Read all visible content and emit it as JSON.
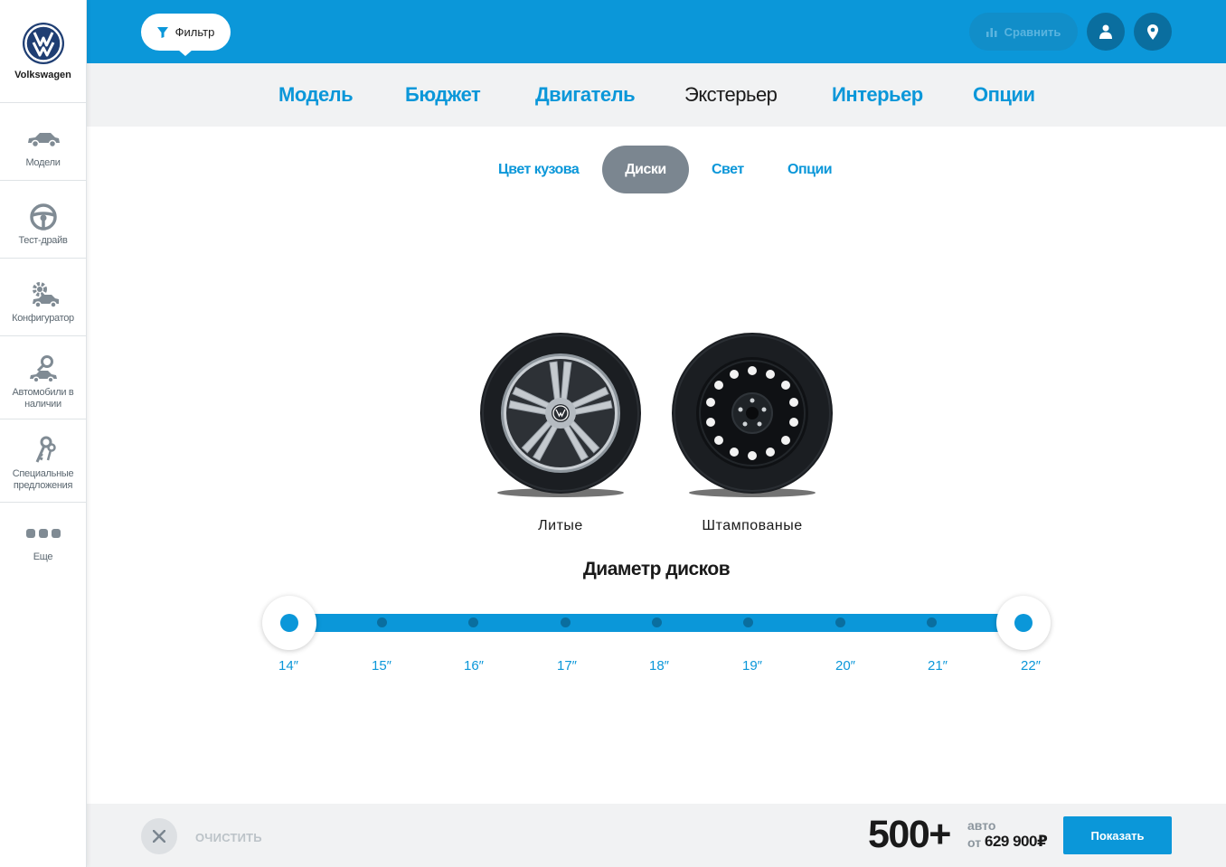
{
  "brand": {
    "name": "Volkswagen",
    "logo_icon": "vw-logo-icon"
  },
  "sidebar": {
    "items": [
      {
        "label": "Модели",
        "icon": "car-icon"
      },
      {
        "label": "Тест-драйв",
        "icon": "steering-wheel-icon"
      },
      {
        "label": "Конфигуратор",
        "icon": "gear-car-icon"
      },
      {
        "label": "Автомобили в наличии",
        "icon": "car-search-icon"
      },
      {
        "label": "Специальные предложения",
        "icon": "keys-icon"
      },
      {
        "label": "Еще",
        "icon": "more-dots-icon"
      }
    ]
  },
  "topbar": {
    "filter_label": "Фильтр",
    "compare_label": "Сравнить",
    "user_icon": "user-icon",
    "location_icon": "location-pin-icon"
  },
  "main_tabs": [
    {
      "label": "Модель"
    },
    {
      "label": "Бюджет"
    },
    {
      "label": "Двигатель"
    },
    {
      "label": "Экстерьер",
      "active": true
    },
    {
      "label": "Интерьер"
    },
    {
      "label": "Опции"
    }
  ],
  "sub_tabs": [
    {
      "label": "Цвет кузова"
    },
    {
      "label": "Диски",
      "active": true
    },
    {
      "label": "Свет"
    },
    {
      "label": "Опции"
    }
  ],
  "wheel_types": [
    {
      "label": "Литые",
      "icon": "alloy-wheel-icon"
    },
    {
      "label": "Штампованые",
      "icon": "steel-wheel-icon"
    }
  ],
  "diameter": {
    "title": "Диаметр дисков",
    "ticks": [
      "14″",
      "15″",
      "16″",
      "17″",
      "18″",
      "19″",
      "20″",
      "21″",
      "22″"
    ],
    "selected_min": "14″",
    "selected_max": "22″"
  },
  "footer": {
    "clear_label": "ОЧИСТИТЬ",
    "count": "500+",
    "count_unit": "авто",
    "price_prefix": "от",
    "price": "629 900₽",
    "show_label": "Показать"
  },
  "colors": {
    "accent": "#0b97d9",
    "dark_accent": "#0a6e9f",
    "muted": "#7b8690"
  }
}
